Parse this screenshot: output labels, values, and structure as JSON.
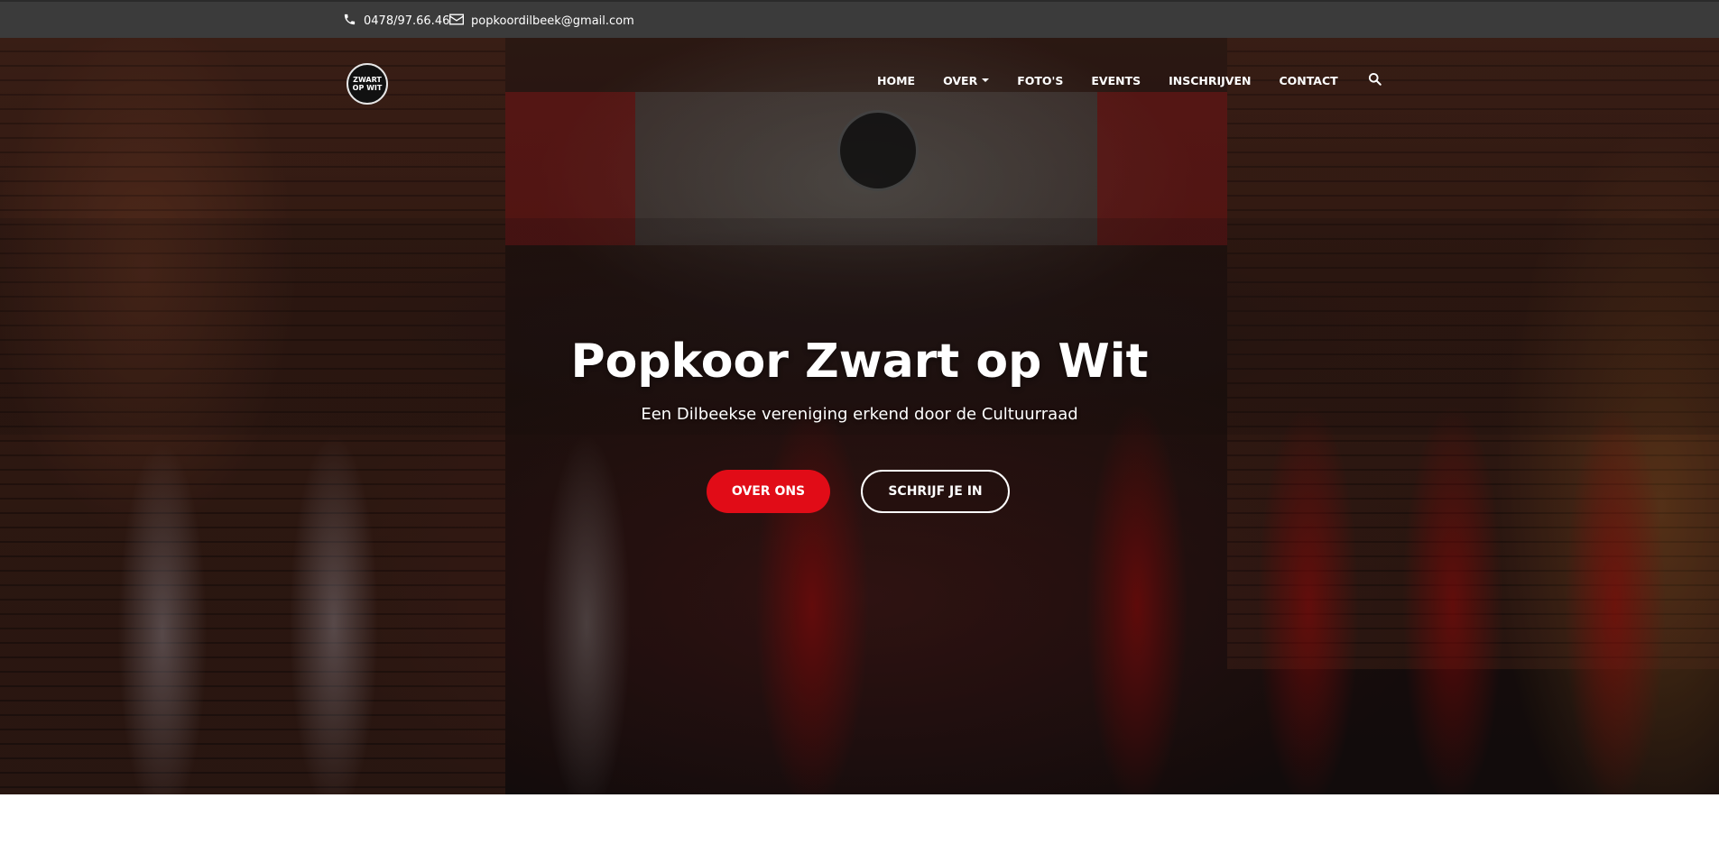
{
  "topbar": {
    "phone": "0478/97.66.46",
    "email": "popkoordilbeek@gmail.com"
  },
  "logo": {
    "line1": "ZWART",
    "line2": "OP WIT"
  },
  "nav": {
    "items": [
      {
        "label": "HOME"
      },
      {
        "label": "OVER"
      },
      {
        "label": "FOTO'S"
      },
      {
        "label": "EVENTS"
      },
      {
        "label": "INSCHRIJVEN"
      },
      {
        "label": "CONTACT"
      }
    ],
    "search_icon": "search-icon"
  },
  "hero": {
    "title": "Popkoor Zwart op Wit",
    "subtitle": "Een Dilbeekse vereniging erkend door de Cultuurraad",
    "primary_button": "OVER ONS",
    "secondary_button": "SCHRIJF JE IN"
  },
  "colors": {
    "topbar_bg": "#3b3b3b",
    "accent_red": "#e10c17",
    "text_white": "#ffffff"
  }
}
